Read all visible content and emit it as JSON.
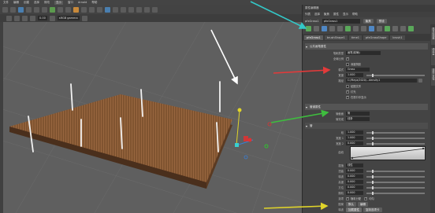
{
  "menubar": {
    "items": [
      "文件",
      "编辑",
      "创建",
      "选择",
      "修改",
      "显示",
      "窗口",
      "Arnold",
      "帮助"
    ]
  },
  "toolbar": {
    "frame_field": "0.00",
    "camera_field": "persp",
    "renderer_field": "sRGB gamma"
  },
  "attribute_editor": {
    "title": "属性编辑器",
    "menu": [
      "列表",
      "选择",
      "聚焦",
      "属性",
      "显示",
      "帮助"
    ],
    "node_tab": "pfxGrass1",
    "node_label": "pfxGrass1",
    "focus_btn": "聚焦",
    "presets_btn": "预设",
    "tabs": [
      "pfxGrass1",
      "brushShape1",
      "time1",
      "pfxGrassShape",
      "brush1",
      "全局"
    ],
    "selected_tab": 0,
    "sections": {
      "common": "公共画笔属性",
      "pipe": "管道属性",
      "tubes": "管",
      "growth": "生长"
    },
    "rows": {
      "brush_type_label": "笔刷类型",
      "brush_type_value": "画笔(精确)",
      "global_scale_label": "全局比例",
      "depth_check": "深度阴影",
      "mode_label": "模式",
      "mode_value": "Grass",
      "width_label": "宽度",
      "width_value": "1.000",
      "path_label": "路径",
      "path_value": "C:/Maya/2020/...density1",
      "check_texture": "贴图文件",
      "check_light": "灯光",
      "check_display": "在视口中显示",
      "tube_section_label": "管截面",
      "tube_section_value": "管",
      "tube_completion_label": "管完成",
      "tube_completion_value": "线条",
      "segments_label": "段",
      "segments_value": "1.000",
      "width1_label": "宽度 1",
      "width1_value": "1.000",
      "width2_label": "宽度 2",
      "width2_value": "0.000",
      "curve_label": "曲线",
      "interp_label": "插值",
      "interp_value": "线性",
      "twist_label": "扭曲",
      "twist_value": "0.000",
      "noise_label": "噪波",
      "noise_value": "0.000",
      "elevation_label": "高度",
      "elevation_value": "0.000",
      "azimuth_label": "方位",
      "azimuth_value": "0.000",
      "rand_label": "随机",
      "rand_value": "0.000",
      "flags_label": "选项",
      "flag1": "随机分配",
      "flag2": "均匀",
      "pattern_label": "图案",
      "pattern_btn1": "默认",
      "pattern_btn2": "编辑",
      "noise_btn": "噪波"
    },
    "bottom_buttons": [
      "选择",
      "加载属性",
      "复制选项卡"
    ],
    "side_tabs": [
      "属性编辑器",
      "通道盒",
      "建模工具包"
    ]
  },
  "colors": {
    "panel": "#444444",
    "viewport": "#5f5f5f",
    "arrow_cyan": "#33c8c8",
    "arrow_red": "#e23a3a",
    "arrow_green": "#3ebd3e",
    "arrow_yellow": "#e0d42a",
    "arrow_white": "#ffffff",
    "grass": "#8a5a34"
  }
}
